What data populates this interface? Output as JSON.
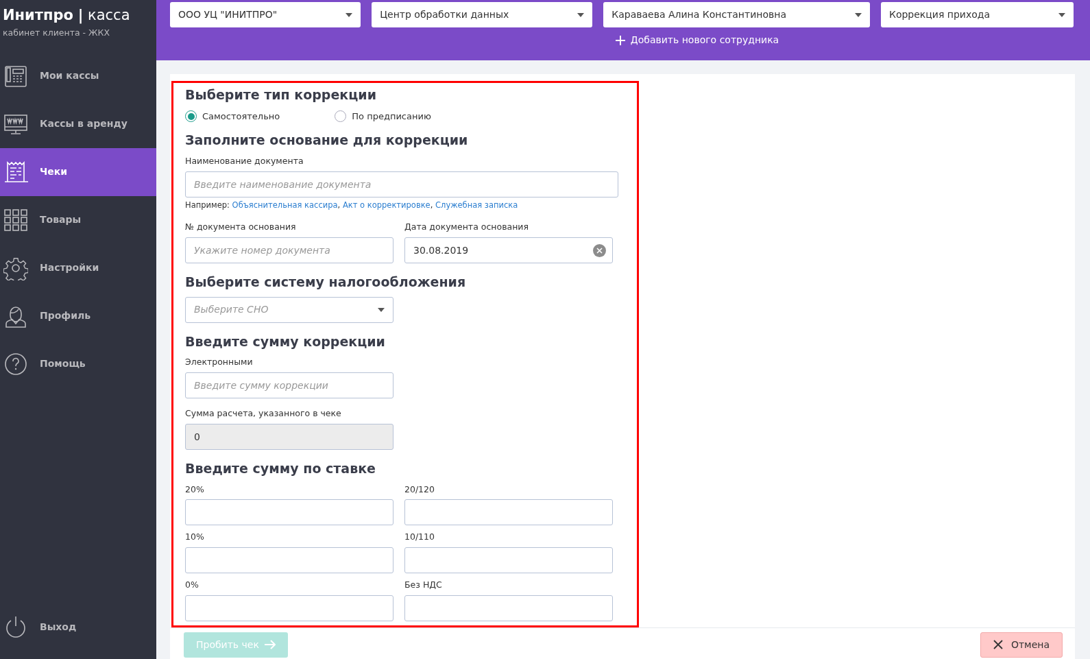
{
  "brand": {
    "name": "Инитпро",
    "separator": "|",
    "product": "касса",
    "subtitle": "кабинет клиента - ЖКХ"
  },
  "sidebar": {
    "items": [
      {
        "label": "Мои кассы",
        "kind": "register",
        "selected": false
      },
      {
        "label": "Кассы в аренду",
        "kind": "monitor",
        "selected": false
      },
      {
        "label": "Чеки",
        "kind": "receipt",
        "selected": true
      },
      {
        "label": "Товары",
        "kind": "grid",
        "selected": false
      },
      {
        "label": "Настройки",
        "kind": "gear",
        "selected": false
      },
      {
        "label": "Профиль",
        "kind": "person",
        "selected": false
      },
      {
        "label": "Помощь",
        "kind": "help",
        "selected": false
      }
    ],
    "logout": {
      "label": "Выход"
    }
  },
  "header": {
    "selects": [
      "ООО УЦ \"ИНИТПРО\"",
      "Центр обработки данных",
      "Караваева Алина Константиновна",
      "Коррекция прихода"
    ],
    "add_employee": "Добавить нового сотрудника"
  },
  "correction_type": {
    "title": "Выберите тип коррекции",
    "options": [
      {
        "label": "Самостоятельно",
        "selected": true
      },
      {
        "label": "По предписанию",
        "selected": false
      }
    ]
  },
  "basis": {
    "title": "Заполните основание для коррекции",
    "document_name": {
      "label": "Наименование документа",
      "placeholder": "Введите наименование документа"
    },
    "example": {
      "prefix": "Например:",
      "separator": ",",
      "links": [
        "Объяснительная кассира",
        "Акт о корректировке",
        "Служебная записка"
      ]
    },
    "document_number": {
      "label": "№ документа основания",
      "placeholder": "Укажите номер документа"
    },
    "document_date": {
      "label": "Дата документа основания",
      "value": "30.08.2019"
    }
  },
  "tax_system": {
    "title": "Выберите систему налогообложения",
    "placeholder": "Выберите СНО"
  },
  "amount": {
    "title": "Введите сумму коррекции",
    "electronic": {
      "label": "Электронными",
      "placeholder": "Введите сумму коррекции"
    },
    "total": {
      "label": "Сумма расчета, указанного в чеке",
      "value": "0",
      "disabled": true
    }
  },
  "rates": {
    "title": "Введите сумму по ставке",
    "fields": [
      {
        "label": "20%"
      },
      {
        "label": "20/120"
      },
      {
        "label": "10%"
      },
      {
        "label": "10/110"
      },
      {
        "label": "0%"
      },
      {
        "label": "Без НДС"
      }
    ]
  },
  "footer": {
    "submit": {
      "label": "Пробить чек",
      "disabled": true
    },
    "cancel": "Отмена"
  }
}
